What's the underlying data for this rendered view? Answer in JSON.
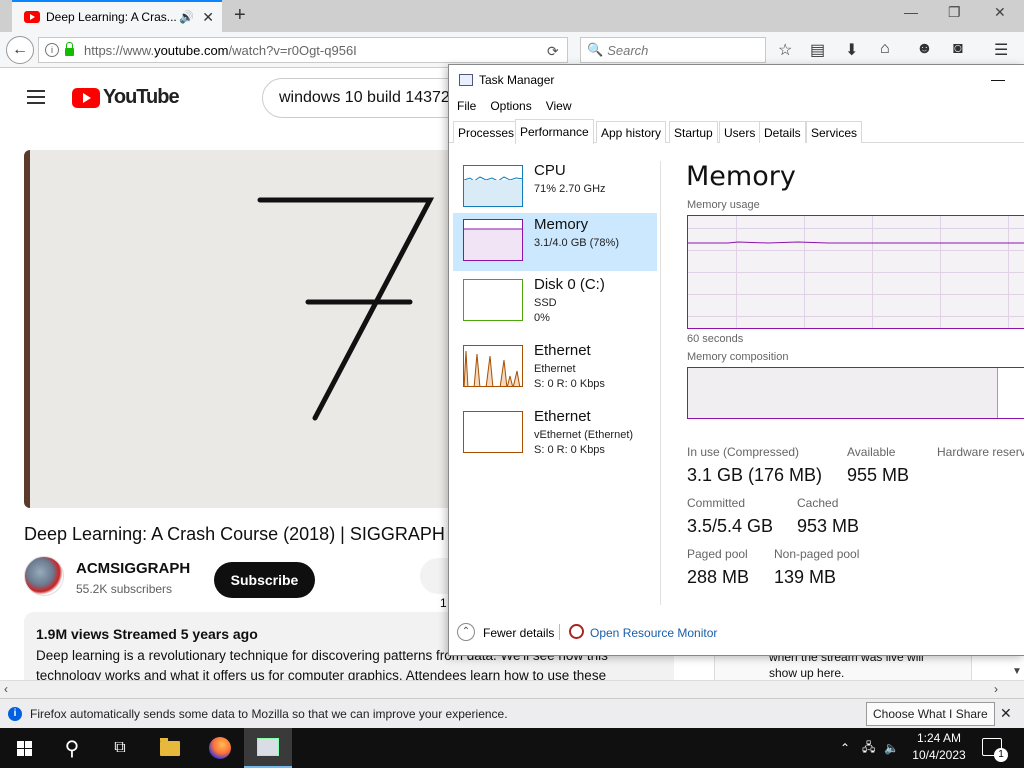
{
  "browser": {
    "tab_title": "Deep Learning: A Cras...",
    "new_tab_glyph": "+",
    "url_prefix": "https://www.",
    "url_domain": "youtube.com",
    "url_suffix": "/watch?v=r0Ogt-q956I",
    "search_placeholder": "Search"
  },
  "youtube": {
    "logo_text": "YouTube",
    "search_value": "windows 10 build 14372",
    "video_title": "Deep Learning: A Crash Course (2018) | SIGGRAPH",
    "channel_name": "ACMSIGGRAPH",
    "subscribers": "55.2K subscribers",
    "subscribe_label": "Subscribe",
    "like_count": "1",
    "views_meta": "1.9M views  Streamed 5 years ago",
    "description_line1": "Deep learning is a revolutionary technique for discovering patterns from data. We'll see how this",
    "description_line2": "technology works and what it offers us for computer graphics. Attendees learn how to use these",
    "live_note_line1": "when the stream was live will",
    "live_note_line2": "show up here."
  },
  "notification": {
    "text": "Firefox automatically sends some data to Mozilla so that we can improve your experience.",
    "button": "Choose What I Share"
  },
  "taskmanager": {
    "title": "Task Manager",
    "menu": [
      "File",
      "Options",
      "View"
    ],
    "tabs": [
      "Processes",
      "Performance",
      "App history",
      "Startup",
      "Users",
      "Details",
      "Services"
    ],
    "resources": [
      {
        "name": "CPU",
        "sub1": "71% 2.70 GHz",
        "sub2": ""
      },
      {
        "name": "Memory",
        "sub1": "3.1/4.0 GB (78%)",
        "sub2": ""
      },
      {
        "name": "Disk 0 (C:)",
        "sub1": "SSD",
        "sub2": "0%"
      },
      {
        "name": "Ethernet",
        "sub1": "Ethernet",
        "sub2": "S: 0 R: 0 Kbps"
      },
      {
        "name": "Ethernet",
        "sub1": "vEthernet (Ethernet)",
        "sub2": "S: 0 R: 0 Kbps"
      }
    ],
    "heading": "Memory",
    "usage_label": "Memory usage",
    "seconds_label": "60 seconds",
    "composition_label": "Memory composition",
    "stats": {
      "in_use_label": "In use (Compressed)",
      "in_use_value": "3.1 GB (176 MB)",
      "available_label": "Available",
      "available_value": "955 MB",
      "hw_reserved_label": "Hardware reserved",
      "committed_label": "Committed",
      "committed_value": "3.5/5.4 GB",
      "cached_label": "Cached",
      "cached_value": "953 MB",
      "paged_label": "Paged pool",
      "paged_value": "288 MB",
      "nonpaged_label": "Non-paged pool",
      "nonpaged_value": "139 MB"
    },
    "fewer_details": "Fewer details",
    "resource_monitor": "Open Resource Monitor",
    "colors": {
      "memory": "#8b12ae",
      "cpu": "#117dbb",
      "disk": "#4da60c",
      "ethernet": "#a74f01"
    }
  },
  "taskbar": {
    "time": "1:24 AM",
    "date": "10/4/2023",
    "notification_count": "1"
  }
}
